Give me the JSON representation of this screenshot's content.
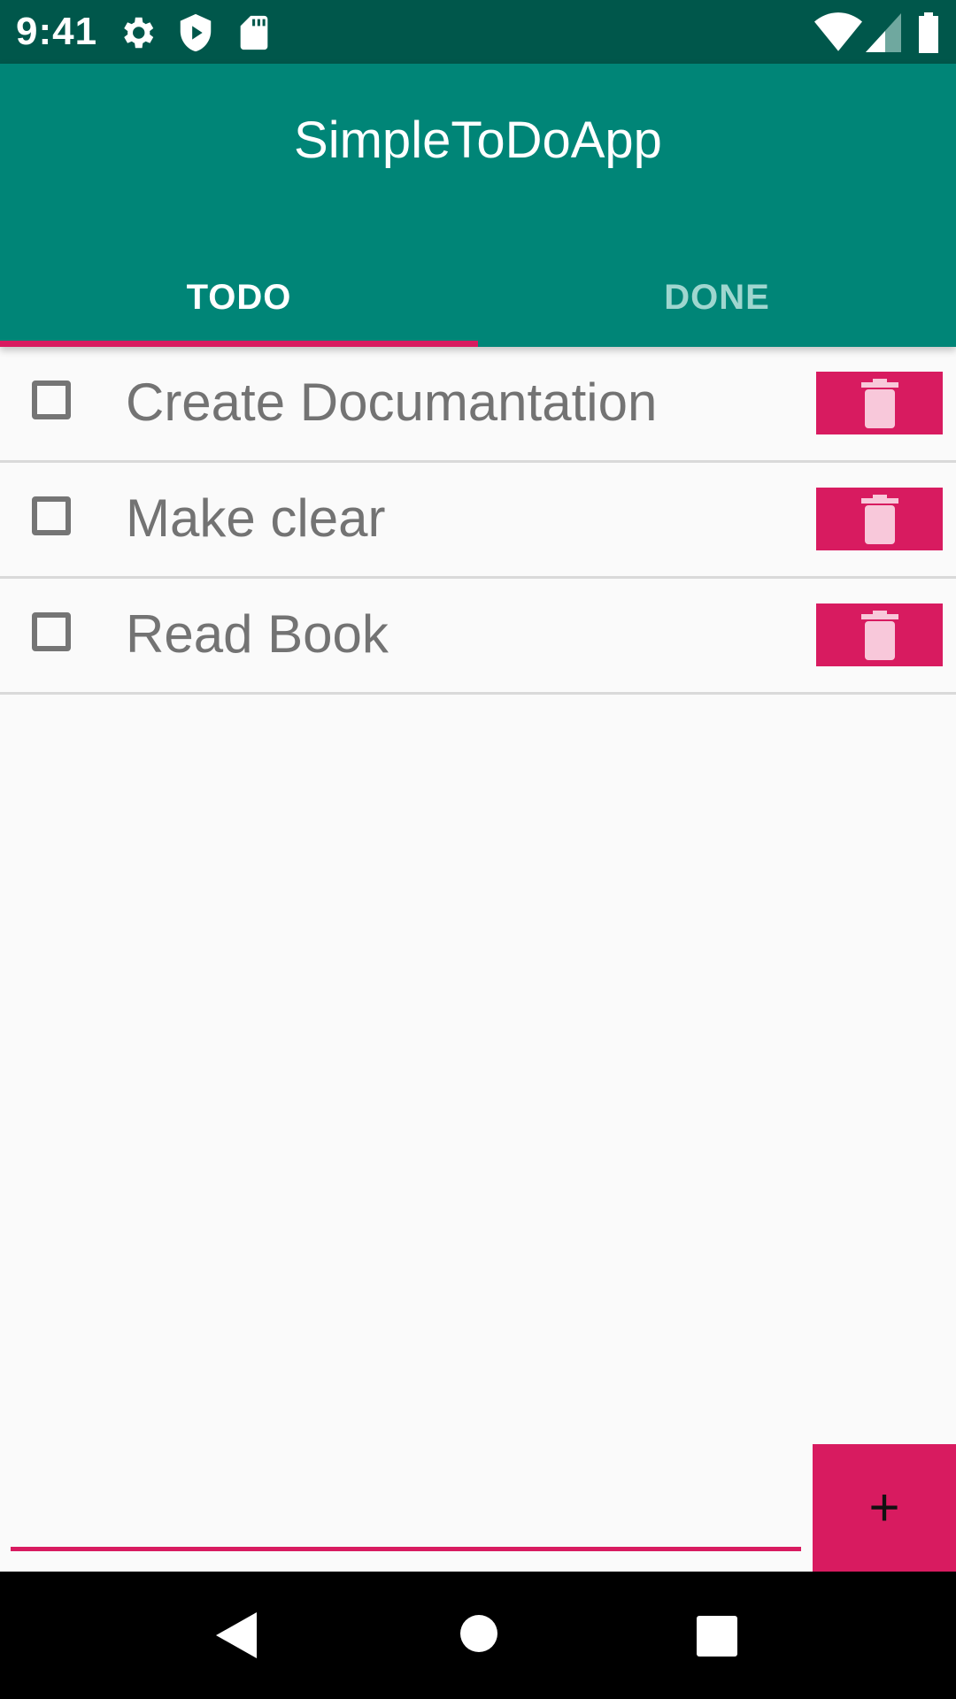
{
  "status_bar": {
    "time": "9:41",
    "left_icons": [
      "gear-icon",
      "shield-play-icon",
      "sd-card-icon"
    ],
    "right_icons": [
      "wifi-icon",
      "cellular-signal-icon",
      "battery-icon"
    ],
    "bar_color": "#00574b"
  },
  "app_bar": {
    "title": "SimpleToDoApp",
    "color": "#008577"
  },
  "tabs": [
    {
      "label": "TODO",
      "selected": true
    },
    {
      "label": "DONE",
      "selected": false
    }
  ],
  "accent_color": "#d81b60",
  "todo_items": [
    {
      "label": "Create Documantation",
      "checked": false
    },
    {
      "label": "Make clear",
      "checked": false
    },
    {
      "label": "Read Book",
      "checked": false
    }
  ],
  "new_todo": {
    "value": "",
    "add_label": "+"
  },
  "nav_bar": {
    "buttons": [
      "back-icon",
      "home-icon",
      "recents-icon"
    ]
  }
}
